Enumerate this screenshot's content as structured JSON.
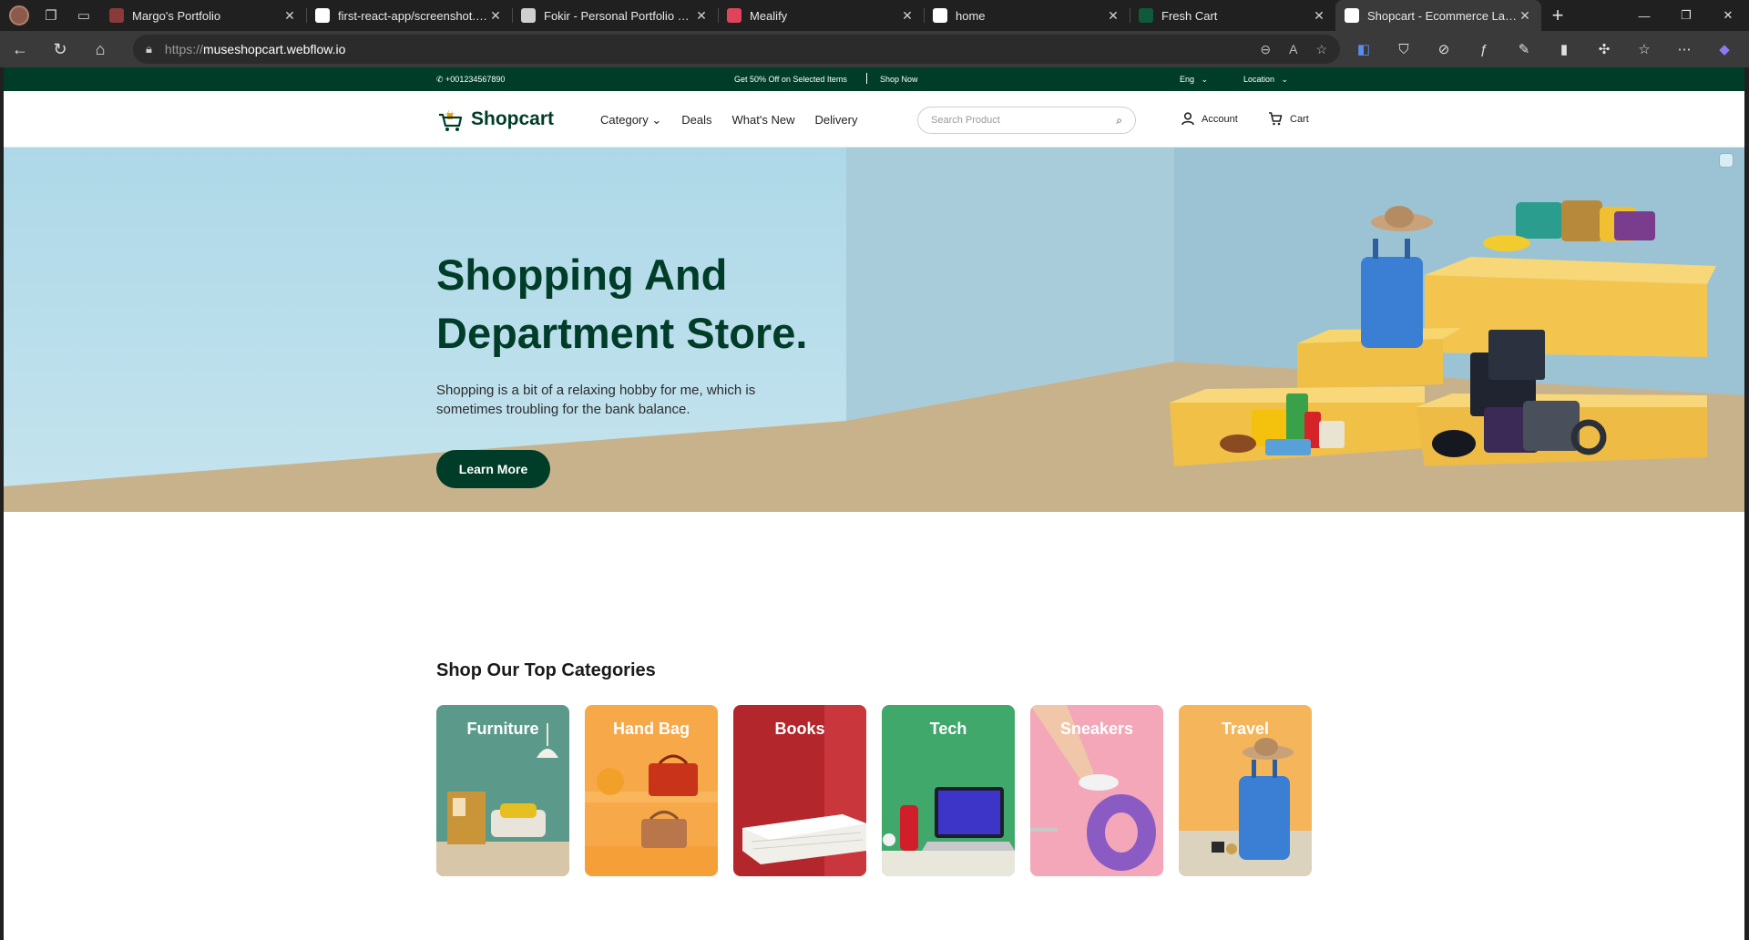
{
  "browser": {
    "tabs": [
      {
        "title": "Margo's Portfolio",
        "favicon": "briefcase-icon",
        "color": "#8b3a3a"
      },
      {
        "title": "first-react-app/screenshot.png",
        "favicon": "github-icon",
        "color": "#ffffff"
      },
      {
        "title": "Fokir - Personal Portfolio Boots",
        "favicon": "globe-icon",
        "color": "#cfcfcf"
      },
      {
        "title": "Mealify",
        "favicon": "mealify-icon",
        "color": "#e0445a"
      },
      {
        "title": "home",
        "favicon": "letter-a-icon",
        "color": "#ffffff"
      },
      {
        "title": "Fresh Cart",
        "favicon": "freshcart-icon",
        "color": "#0f5a3a"
      },
      {
        "title": "Shopcart - Ecommerce Landing",
        "favicon": "shopcart-icon",
        "color": "#ffffff"
      }
    ],
    "close_glyph": "✕",
    "new_tab_glyph": "+",
    "url_prefix": "https://",
    "url_host": "museshopcart.webflow.io"
  },
  "topbar": {
    "phone": "+001234567890",
    "promo": "Get 50% Off on Selected Items",
    "shop_now": "Shop Now",
    "language": "Eng",
    "location": "Location"
  },
  "header": {
    "logo": "Shopcart",
    "menu": [
      "Category",
      "Deals",
      "What's New",
      "Delivery"
    ],
    "search_placeholder": "Search Product",
    "account": "Account",
    "cart": "Cart"
  },
  "hero": {
    "title": "Shopping And Department Store.",
    "text": "Shopping is a bit of a relaxing hobby for me, which is sometimes troubling for the bank balance.",
    "cta": "Learn More"
  },
  "categories": {
    "title": "Shop Our Top Categories",
    "items": [
      {
        "label": "Furniture",
        "color": "#5b9a8b"
      },
      {
        "label": "Hand Bag",
        "color": "#f7a94a"
      },
      {
        "label": "Books",
        "color": "#b3262b"
      },
      {
        "label": "Tech",
        "color": "#3fa86a"
      },
      {
        "label": "Sneakers",
        "color": "#f3a7b8"
      },
      {
        "label": "Travel",
        "color": "#f5b55a"
      }
    ]
  },
  "colors": {
    "brand": "#003d29",
    "accent_yellow": "#f4c84d"
  }
}
